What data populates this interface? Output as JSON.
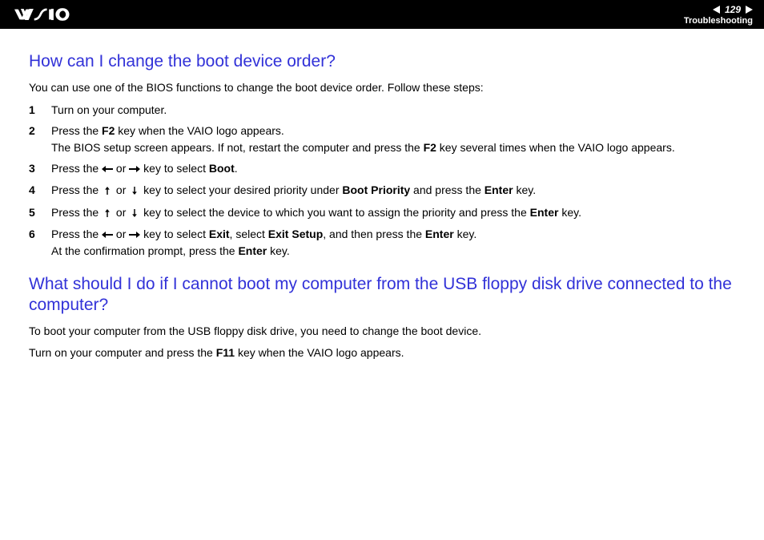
{
  "header": {
    "page_number": "129",
    "section": "Troubleshooting"
  },
  "q1": {
    "title": "How can I change the boot device order?",
    "intro": "You can use one of the BIOS functions to change the boot device order. Follow these steps:",
    "steps": {
      "s1": "Turn on your computer.",
      "s2a": "Press the ",
      "s2b": "F2",
      "s2c": " key when the VAIO logo appears.",
      "s2d": "The BIOS setup screen appears. If not, restart the computer and press the ",
      "s2e": "F2",
      "s2f": " key several times when the VAIO logo appears.",
      "s3a": "Press the ",
      "s3b": " or ",
      "s3c": " key to select ",
      "s3d": "Boot",
      "s3e": ".",
      "s4a": "Press the ",
      "s4b": " or ",
      "s4c": " key to select your desired priority under ",
      "s4d": "Boot Priority",
      "s4e": " and press the ",
      "s4f": "Enter",
      "s4g": " key.",
      "s5a": "Press the ",
      "s5b": " or ",
      "s5c": " key to select the device to which you want to assign the priority and press the ",
      "s5d": "Enter",
      "s5e": " key.",
      "s6a": "Press the ",
      "s6b": " or ",
      "s6c": " key to select ",
      "s6d": "Exit",
      "s6e": ", select ",
      "s6f": "Exit Setup",
      "s6g": ", and then press the ",
      "s6h": "Enter",
      "s6i": " key.",
      "s6j": "At the confirmation prompt, press the ",
      "s6k": "Enter",
      "s6l": " key."
    }
  },
  "q2": {
    "title": "What should I do if I cannot boot my computer from the USB floppy disk drive connected to the computer?",
    "p1": "To boot your computer from the USB floppy disk drive, you need to change the boot device.",
    "p2a": "Turn on your computer and press the ",
    "p2b": "F11",
    "p2c": " key when the VAIO logo appears."
  }
}
